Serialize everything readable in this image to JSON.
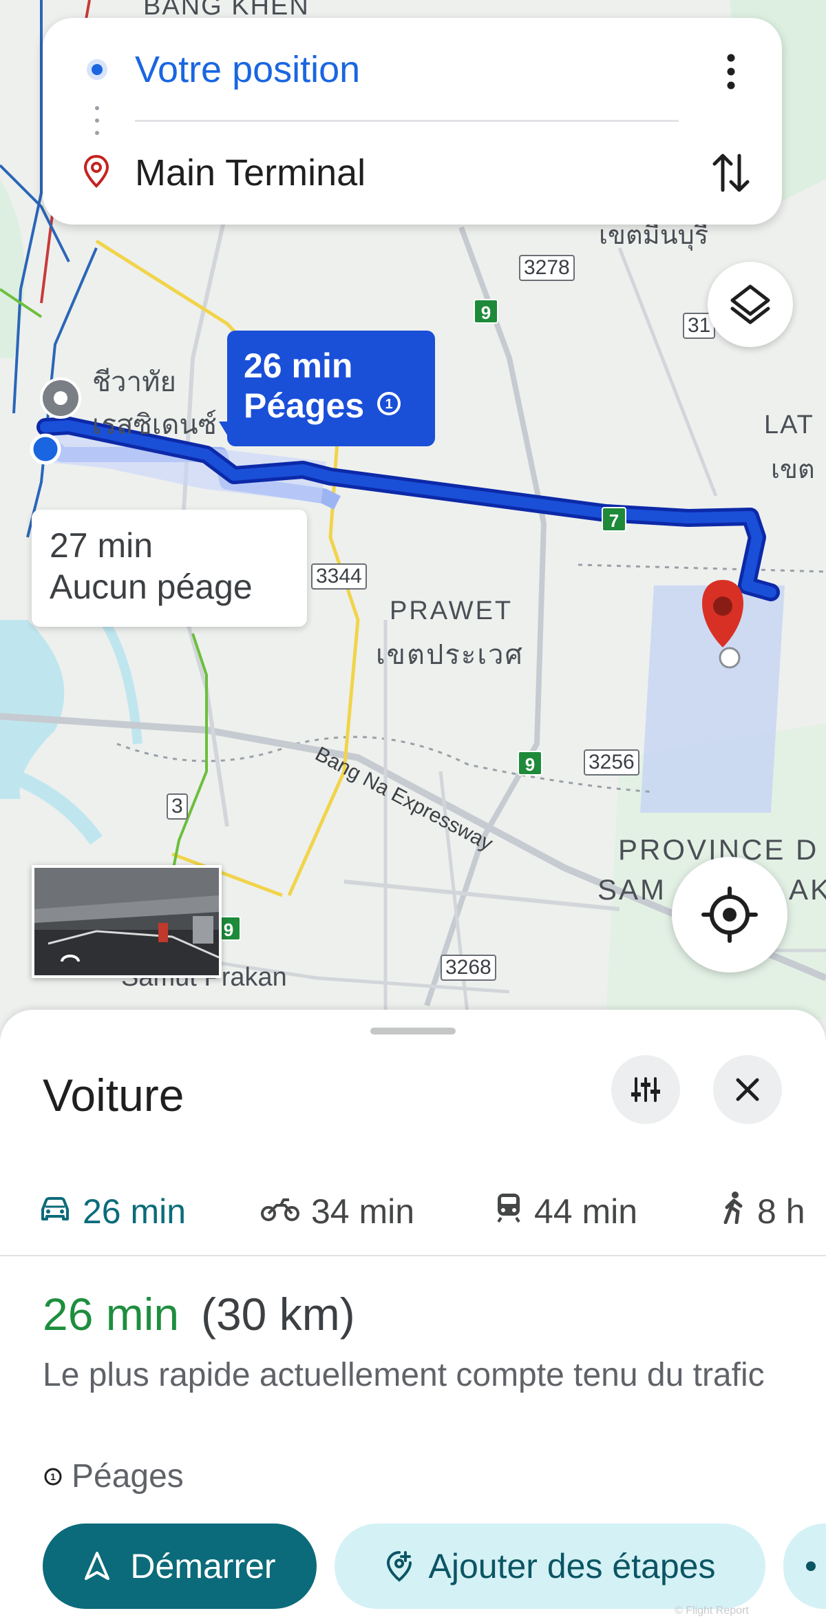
{
  "route_card": {
    "origin": "Votre position",
    "destination": "Main Terminal"
  },
  "map": {
    "labels": {
      "bang_khen": "BANG KHEN",
      "chiwathai": "ชีวาทัย",
      "residence": "เรสซิเดนซ์",
      "prawet_en": "PRAWET",
      "prawet_th": "เขตประเวศ",
      "lat": "LAT",
      "khet": "เขต",
      "min_buri": "เขตมีนบุรี",
      "expressway": "Bang Na Expressway",
      "province_1": "PROVINCE D",
      "province_2": "SAM",
      "province_3": "AK",
      "samut_prakan": "Samut Prakan"
    },
    "road_shields": {
      "r3278": "3278",
      "r31": "31",
      "r3344": "3344",
      "r3256": "3256",
      "r3": "3",
      "r3268": "3268"
    },
    "highway_shields": {
      "h9a": "9",
      "h7": "7",
      "h9b": "9",
      "h9c": "9"
    },
    "callout_toll": {
      "time": "26 min",
      "label": "Péages"
    },
    "callout_free": {
      "time": "27 min",
      "label": "Aucun péage"
    }
  },
  "sheet": {
    "title": "Voiture",
    "tabs": [
      {
        "mode": "car",
        "label": "26 min",
        "icon": "car-icon",
        "active": true
      },
      {
        "mode": "motorcycle",
        "label": "34 min",
        "icon": "motorcycle-icon",
        "active": false
      },
      {
        "mode": "transit",
        "label": "44 min",
        "icon": "train-icon",
        "active": false
      },
      {
        "mode": "walk",
        "label": "8 h",
        "icon": "walk-icon",
        "active": false
      }
    ],
    "duration": "26 min",
    "distance": "(30 km)",
    "description": "Le plus rapide actuellement compte tenu du trafic",
    "tolls": "Péages",
    "start_label": "Démarrer",
    "add_stops_label": "Ajouter des étapes"
  },
  "watermark": "© Flight Report",
  "colors": {
    "accent_blue": "#1a66e0",
    "route_blue": "#1a4fd8",
    "teal": "#0b6b7a",
    "green_time": "#1e8e3e",
    "pin_red": "#d93025"
  }
}
